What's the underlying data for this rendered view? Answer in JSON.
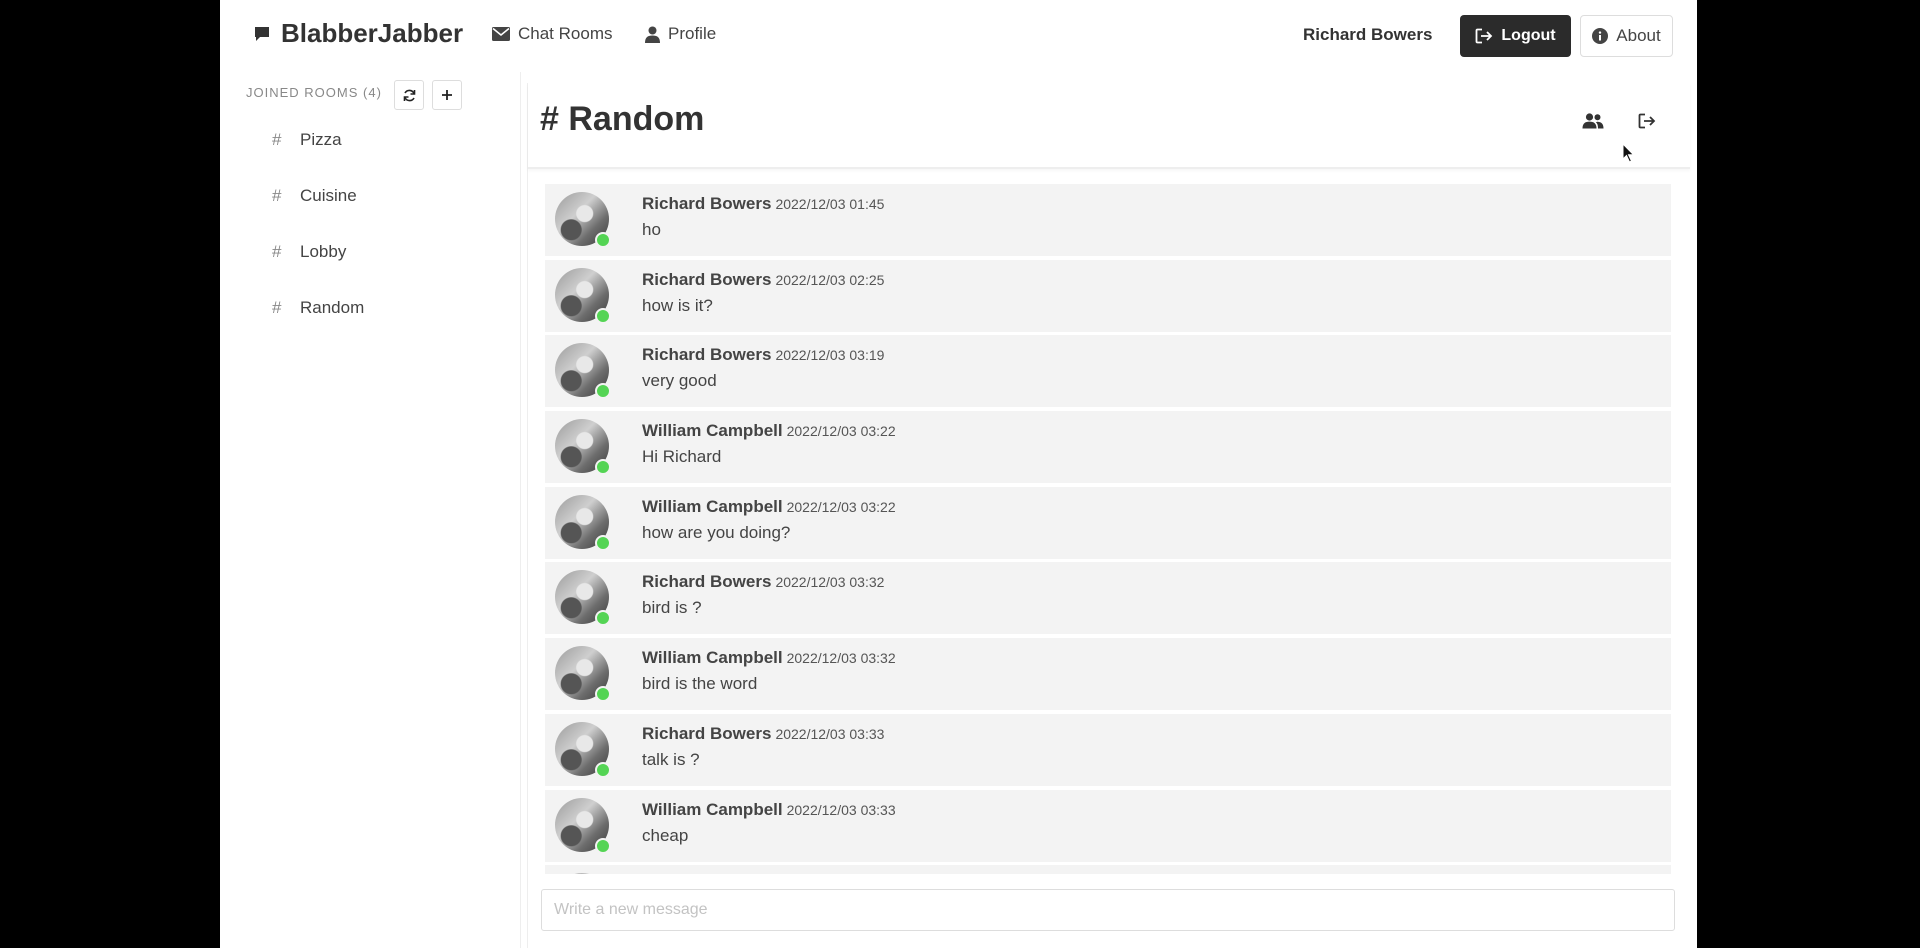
{
  "navbar": {
    "brand": "BlabberJabber",
    "chat_rooms": "Chat Rooms",
    "profile": "Profile",
    "user_name": "Richard Bowers",
    "logout": "Logout",
    "about": "About"
  },
  "sidebar": {
    "header": "JOINED ROOMS (4)",
    "rooms": [
      {
        "label": "Pizza"
      },
      {
        "label": "Cuisine"
      },
      {
        "label": "Lobby"
      },
      {
        "label": "Random"
      }
    ]
  },
  "room": {
    "title": "# Random"
  },
  "messages": [
    {
      "author": "Richard Bowers",
      "time": "2022/12/03 01:45",
      "text": "ho"
    },
    {
      "author": "Richard Bowers",
      "time": "2022/12/03 02:25",
      "text": "how is it?"
    },
    {
      "author": "Richard Bowers",
      "time": "2022/12/03 03:19",
      "text": "very good"
    },
    {
      "author": "William Campbell",
      "time": "2022/12/03 03:22",
      "text": "Hi Richard"
    },
    {
      "author": "William Campbell",
      "time": "2022/12/03 03:22",
      "text": "how are you doing?"
    },
    {
      "author": "Richard Bowers",
      "time": "2022/12/03 03:32",
      "text": "bird is ?"
    },
    {
      "author": "William Campbell",
      "time": "2022/12/03 03:32",
      "text": "bird is the word"
    },
    {
      "author": "Richard Bowers",
      "time": "2022/12/03 03:33",
      "text": "talk is ?"
    },
    {
      "author": "William Campbell",
      "time": "2022/12/03 03:33",
      "text": "cheap"
    },
    {
      "author": "",
      "time": "",
      "text": ""
    }
  ],
  "composer": {
    "placeholder": "Write a new message"
  },
  "colors": {
    "online": "#54d454",
    "logout_bg": "#2b2b2b",
    "message_bg": "#f3f3f3"
  }
}
